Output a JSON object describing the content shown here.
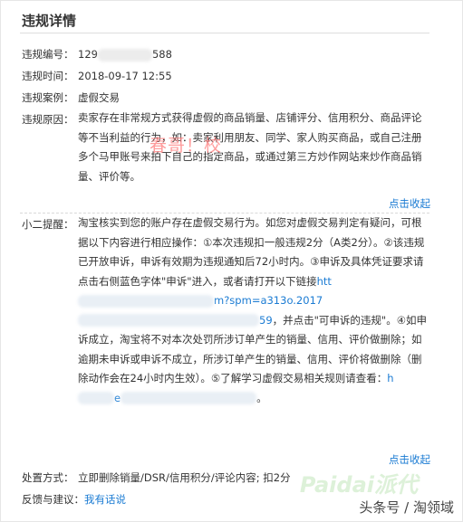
{
  "title": "违规详情",
  "fields": {
    "number": {
      "label": "违规编号：",
      "prefix": "129",
      "suffix": "588"
    },
    "time": {
      "label": "违规时间：",
      "value": "2018-09-17 12:55"
    },
    "case": {
      "label": "违规案例：",
      "value": "虚假交易"
    },
    "reason": {
      "label": "违规原因：",
      "text": "卖家存在非常规方式获得虚假的商品销量、店铺评分、信用积分、商品评论等不当利益的行为，如：卖家利用朋友、同学、家人购买商品，或自己注册多个马甲账号来拍下自己的指定商品，或通过第三方炒作网站来炒作商品销量、评价等。",
      "collapse": "点击收起"
    },
    "tip": {
      "label": "小二提醒：",
      "text1": "淘宝核实到您的账户存在虚假交易行为。如您对虚假交易判定有疑问，可根据以下内容进行相应操作：①本次违规扣一般违规2分（A类2分）。②该违规已开放申诉，申诉有效期为违规通知后72小时内。③申诉及具体凭证要求请点击右侧蓝色字体\"申诉\"进入，或者请打开以下链接",
      "link_start": "htt",
      "link_mid": "m?spm",
      "link_line2": "=a313o.2017",
      "link_end": "59",
      "text2": "，并点击\"可申诉的违规\"。④如申诉成立，淘宝将不对本次处罚所涉订单产生的销量、信用、评价做删除；如逾期未申诉或申诉不成立，所涉订单产生的销量、信用、评价将做删除（删除动作会在24小时内生效）。⑤了解学习虚假交易相关规则请查看：",
      "link2_start": "h",
      "link2_line2": "e",
      "text3": "。",
      "collapse": "点击收起"
    },
    "action": {
      "label": "处置方式：",
      "value": "立即删除销量/DSR/信用积分/评论内容; 扣2分"
    },
    "feedback": {
      "label": "反馈与建议：",
      "link": "我有话说"
    }
  },
  "watermark": "春哥！校",
  "brand": "头条号 / 淘领域",
  "brand_logo": "Paidai派代"
}
